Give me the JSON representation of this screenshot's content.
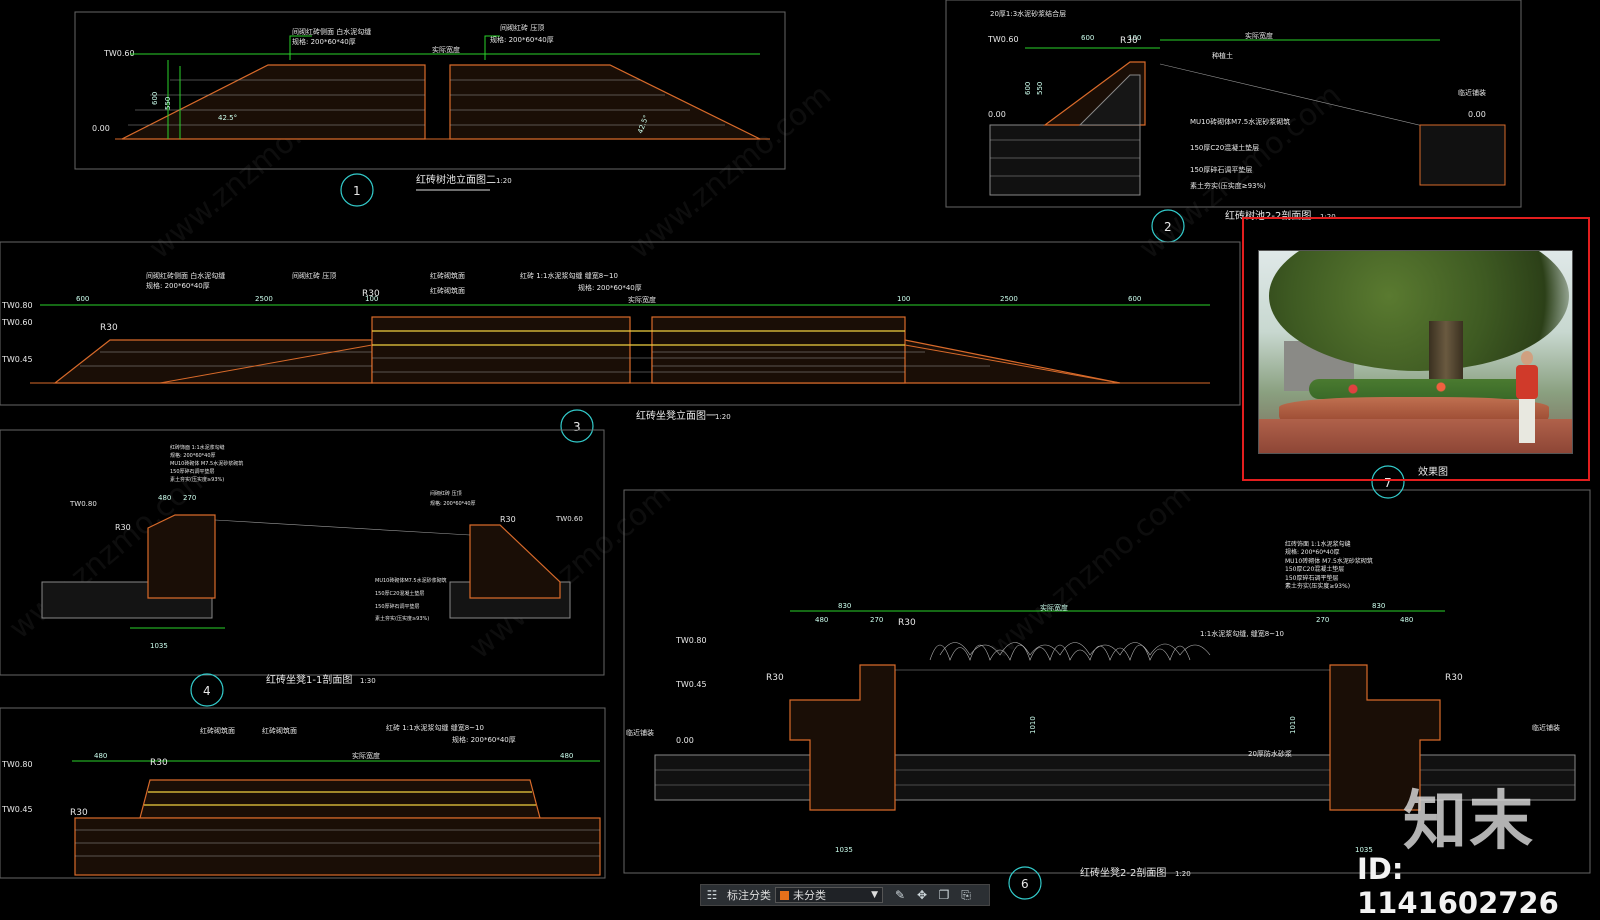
{
  "drawing": {
    "views": [
      {
        "num": "1",
        "title": "红砖树池立面图二",
        "scale": "1:20"
      },
      {
        "num": "2",
        "title": "红砖树池2-2剖面图",
        "scale": "1:20"
      },
      {
        "num": "3",
        "title": "红砖坐凳立面图一",
        "scale": "1:20"
      },
      {
        "num": "4",
        "title": "红砖坐凳1-1剖面图",
        "scale": "1:30"
      },
      {
        "num": "6",
        "title": "红砖坐凳2-2剖面图",
        "scale": "1:20"
      },
      {
        "num": "7",
        "title": "效果图",
        "scale": ""
      }
    ],
    "labels": {
      "v1_note_a": "间砌红砖侧面 白水泥勾缝",
      "v1_note_a2": "规格: 200*60*40厚",
      "v1_note_b": "间砌红砖 压顶",
      "v1_note_b2": "规格: 200*60*40厚",
      "v1_actual": "实际宽度",
      "tw060": "TW0.60",
      "tw080": "TW0.80",
      "tw045": "TW0.45",
      "zero": "0.00",
      "d600": "600",
      "d550": "550",
      "d50": "50",
      "d2500": "2500",
      "d100": "100",
      "d830": "830",
      "d480": "480",
      "d270": "270",
      "d1035": "1035",
      "d1010": "1010",
      "slope": "42.5°",
      "r30": "R30",
      "v2_a": "20厚1:3水泥砂浆结合层",
      "v2_b": "MU10砖砌体M7.5水泥砂浆砌筑",
      "v2_c": "150厚C20混凝土垫层",
      "v2_d": "150厚碎石调平垫层",
      "v2_e": "素土夯实(压实度≥93%)",
      "v2_f": "种植土",
      "v2_g": "临近铺装",
      "v3_a": "红砖砌筑面",
      "v3_b": "红砖砌筑面",
      "v3_c": "红砖 1:1水泥浆勾缝 缝宽8~10",
      "v6_a": "红砖饰面 1:1水泥浆勾缝",
      "v6_b": "规格: 200*60*40厚",
      "v6_c": "MU10砖砌体 M7.5水泥砂浆砌筑",
      "v6_d": "150厚C20混凝土垫层",
      "v6_e": "150厚碎石调平垫层",
      "v6_f": "素土夯实(压实度≥93%)",
      "v6_g": "1:1水泥浆勾缝, 缝宽8~10",
      "v6_h": "20厚防水砂浆",
      "watermark": "www.znzmo.com"
    }
  },
  "branding": {
    "logo": "知末",
    "id_text": "ID: 1141602726"
  },
  "toolbar": {
    "label": "标注分类",
    "select_value": "未分类",
    "accent": "#e6701a"
  }
}
